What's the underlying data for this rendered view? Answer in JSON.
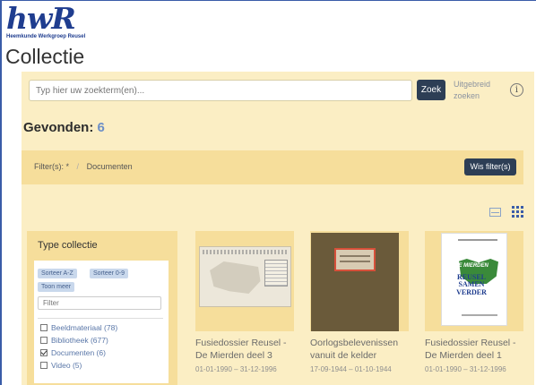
{
  "logo": {
    "mark": "hwR",
    "subtitle": "Heemkunde Werkgroep Reusel"
  },
  "page_title": "Collectie",
  "search": {
    "placeholder": "Typ hier uw zoekterm(en)...",
    "button_label": "Zoek",
    "advanced_label": "Uitgebreid zoeken",
    "info_icon": "ⓘ"
  },
  "results": {
    "found_label": "Gevonden:",
    "count": "6"
  },
  "filter_bar": {
    "label": "Filter(s):",
    "star": "*",
    "separator": "/",
    "active_filter": "Documenten",
    "clear_label": "Wis filter(s)"
  },
  "view_toggle": {
    "list_icon": "list-view-icon",
    "grid_icon": "grid-view-icon"
  },
  "sidebar": {
    "title": "Type collectie",
    "chips": [
      "Sorteer A-Z",
      "Sorteer 0-9",
      "Toon meer"
    ],
    "filter_placeholder": "Filter",
    "options": [
      {
        "label": "Beeldmateriaal (78)",
        "checked": false
      },
      {
        "label": "Bibliotheek (677)",
        "checked": false
      },
      {
        "label": "Documenten (6)",
        "checked": true
      },
      {
        "label": "Video (5)",
        "checked": false
      }
    ]
  },
  "cards": [
    {
      "title_line1": "Fusiedossier Reusel -",
      "title_line2": "De Mierden deel 3",
      "date": "01-01-1990 – 31-12-1996",
      "thumb": "map"
    },
    {
      "title_line1": "Oorlogsbelevenissen",
      "title_line2": "vanuit de kelder",
      "date": "17-09-1944 – 01-10-1944",
      "thumb": "book"
    },
    {
      "title_line1": "Fusiedossier Reusel -",
      "title_line2": "De Mierden deel 1",
      "date": "01-01-1990 – 31-12-1996",
      "thumb": "cover",
      "cover_text_1": "DE MIERDEN",
      "cover_text_2": "REUSEL",
      "cover_text_3": "SAMEN VERDER"
    }
  ]
}
